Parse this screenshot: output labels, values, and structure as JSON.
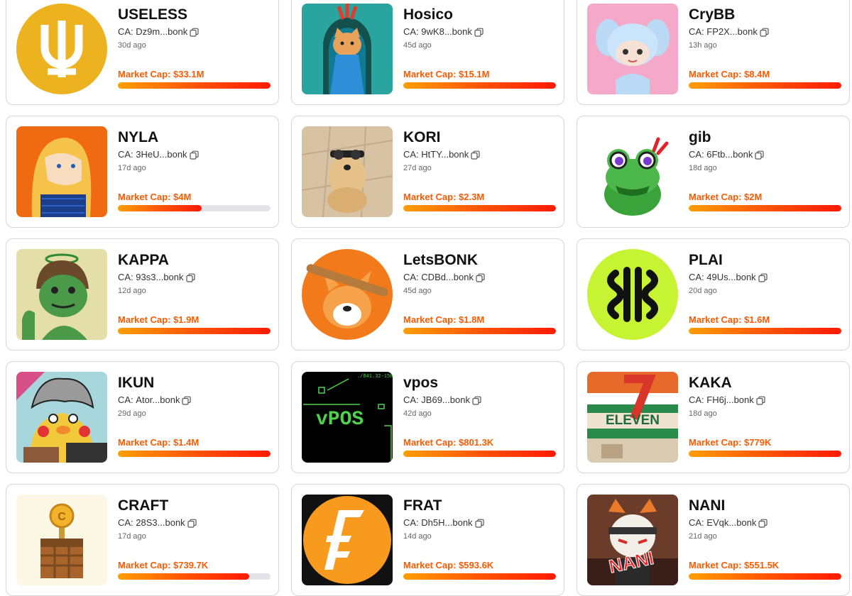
{
  "labels": {
    "ca_prefix": "CA: ",
    "mcap_prefix": "Market Cap: "
  },
  "colors": {
    "accent": "#ff5a00",
    "bar_start": "#ff9e00",
    "bar_end": "#ff1a00",
    "bar_track": "#e3e3e8"
  },
  "tokens": [
    {
      "name": "USELESS",
      "ca": "Dz9m...bonk",
      "age": "30d ago",
      "mcap": "$33.1M",
      "progress": 1.0,
      "icon": "useless-logo-icon"
    },
    {
      "name": "Hosico",
      "ca": "9wK8...bonk",
      "age": "45d ago",
      "mcap": "$15.1M",
      "progress": 1.0,
      "icon": "hosico-cat-image"
    },
    {
      "name": "CryBB",
      "ca": "FP2X...bonk",
      "age": "13h ago",
      "mcap": "$8.4M",
      "progress": 1.0,
      "icon": "crybb-doll-image"
    },
    {
      "name": "NYLA",
      "ca": "3HeU...bonk",
      "age": "17d ago",
      "mcap": "$4M",
      "progress": 0.55,
      "icon": "nyla-anime-girl-image"
    },
    {
      "name": "KORI",
      "ca": "HtTY...bonk",
      "age": "27d ago",
      "mcap": "$2.3M",
      "progress": 1.0,
      "icon": "kori-dog-image"
    },
    {
      "name": "gib",
      "ca": "6Ftb...bonk",
      "age": "18d ago",
      "mcap": "$2M",
      "progress": 1.0,
      "icon": "gib-frog-image"
    },
    {
      "name": "KAPPA",
      "ca": "93s3...bonk",
      "age": "12d ago",
      "mcap": "$1.9M",
      "progress": 1.0,
      "icon": "kappa-creature-image"
    },
    {
      "name": "LetsBONK",
      "ca": "CDBd...bonk",
      "age": "45d ago",
      "mcap": "$1.8M",
      "progress": 1.0,
      "icon": "letsbonk-dog-image"
    },
    {
      "name": "PLAI",
      "ca": "49Us...bonk",
      "age": "20d ago",
      "mcap": "$1.6M",
      "progress": 1.0,
      "icon": "plai-logo-icon"
    },
    {
      "name": "IKUN",
      "ca": "Ator...bonk",
      "age": "29d ago",
      "mcap": "$1.4M",
      "progress": 1.0,
      "icon": "ikun-chick-image"
    },
    {
      "name": "vpos",
      "ca": "JB69...bonk",
      "age": "42d ago",
      "mcap": "$801.3K",
      "progress": 1.0,
      "icon": "vpos-terminal-image",
      "art_text": "vPOS",
      "art_small": "./841.32-158"
    },
    {
      "name": "KAKA",
      "ca": "FH6j...bonk",
      "age": "18d ago",
      "mcap": "$779K",
      "progress": 1.0,
      "icon": "kaka-eleven-image",
      "art_text": "ELEVEN"
    },
    {
      "name": "CRAFT",
      "ca": "28S3...bonk",
      "age": "17d ago",
      "mcap": "$739.7K",
      "progress": 0.86,
      "icon": "craft-chest-image"
    },
    {
      "name": "FRAT",
      "ca": "Dh5H...bonk",
      "age": "14d ago",
      "mcap": "$593.6K",
      "progress": 1.0,
      "icon": "frat-coin-icon"
    },
    {
      "name": "NANI",
      "ca": "EVqk...bonk",
      "age": "21d ago",
      "mcap": "$551.5K",
      "progress": 1.0,
      "icon": "nani-fox-image",
      "art_text": "NANI"
    }
  ]
}
